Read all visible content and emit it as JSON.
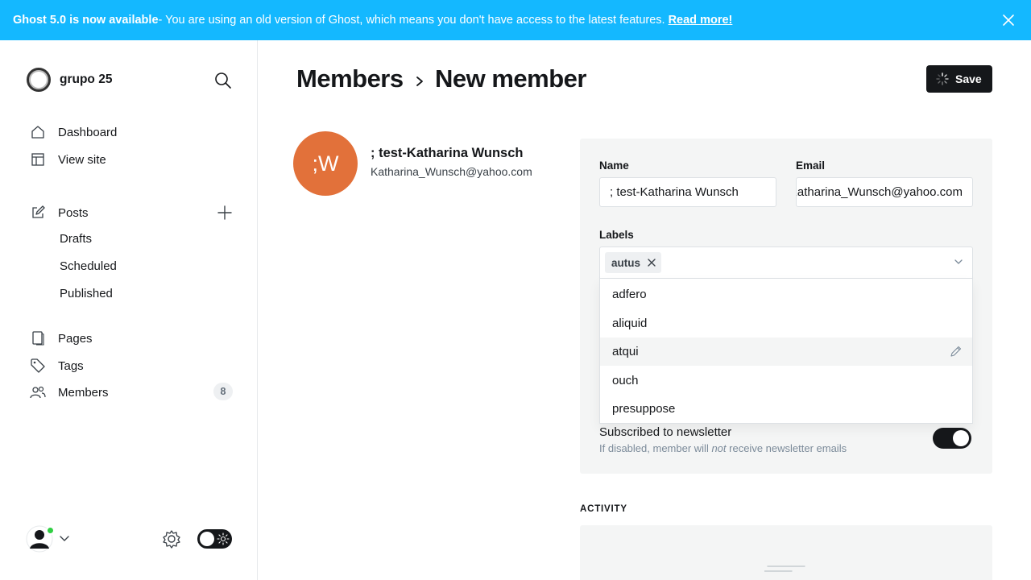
{
  "banner": {
    "bold": "Ghost 5.0 is now available",
    "text": " - You are using an old version of Ghost, which means you don't have access to the latest features.",
    "link": "Read more!"
  },
  "sidebar": {
    "site_name": "grupo 25",
    "nav": {
      "dashboard": "Dashboard",
      "view_site": "View site",
      "posts": "Posts",
      "drafts": "Drafts",
      "scheduled": "Scheduled",
      "published": "Published",
      "pages": "Pages",
      "tags": "Tags",
      "members": "Members",
      "members_count": "8"
    }
  },
  "header": {
    "parent": "Members",
    "current": "New member",
    "save_label": "Save"
  },
  "member": {
    "initials": ";W",
    "name": "; test-Katharina Wunsch",
    "email": "Katharina_Wunsch@yahoo.com",
    "avatar_color": "#e2713a"
  },
  "form": {
    "name_label": "Name",
    "name_value": ";   test-Katharina Wunsch",
    "email_label": "Email",
    "email_value": "Katharina_Wunsch@yahoo.com",
    "labels_label": "Labels",
    "selected_label": "autus",
    "options": [
      "adfero",
      "aliquid",
      "atqui",
      "ouch",
      "presuppose"
    ],
    "newsletter_title": "Subscribed to newsletter",
    "newsletter_desc_before": "If disabled, member will ",
    "newsletter_desc_em": "not",
    "newsletter_desc_after": " receive newsletter emails",
    "newsletter_enabled": true
  },
  "activity": {
    "title": "ACTIVITY"
  },
  "colors": {
    "banner": "#14b8ff",
    "primary": "#15171a",
    "online": "#30cf43"
  }
}
